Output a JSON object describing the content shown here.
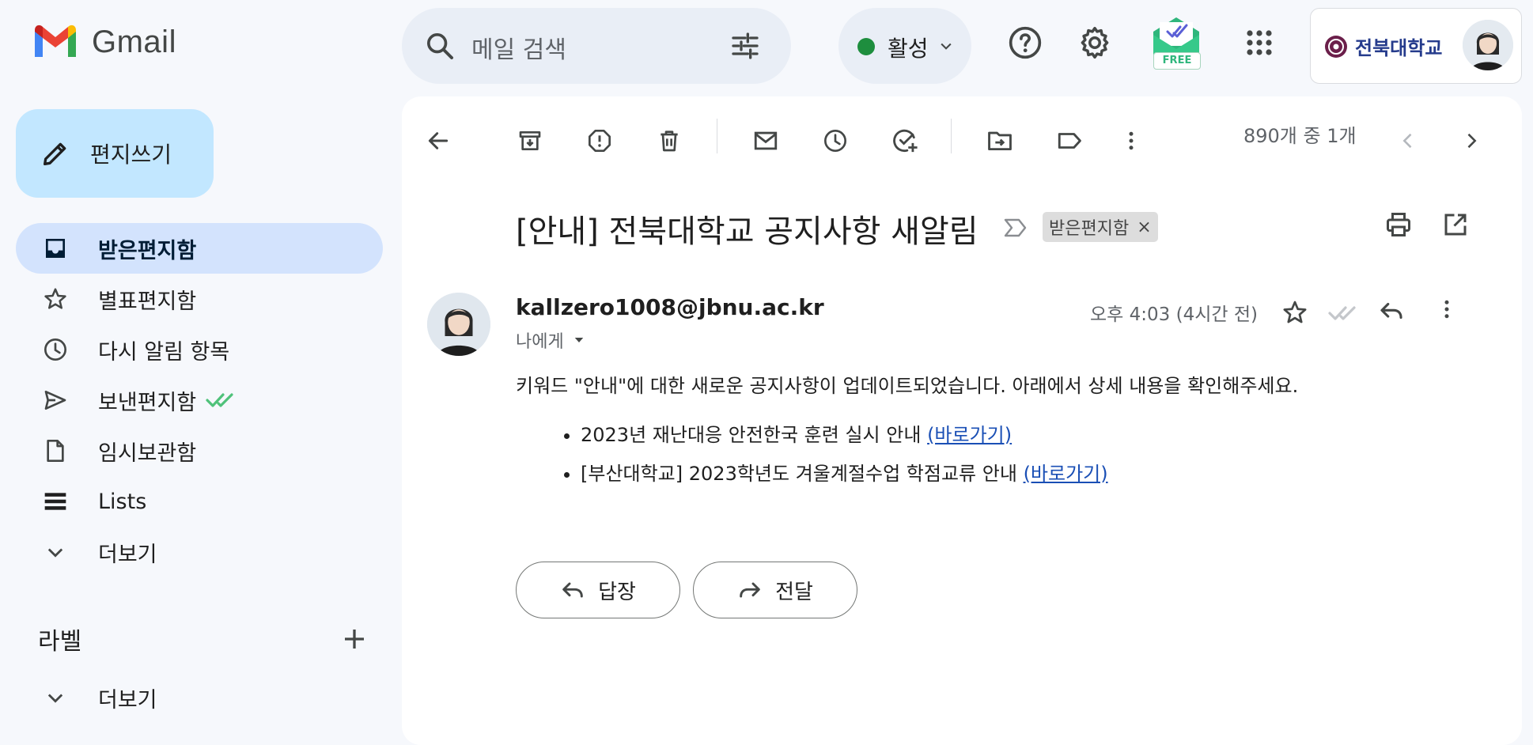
{
  "header": {
    "app_name": "Gmail",
    "search_placeholder": "메일 검색",
    "status_label": "활성",
    "free_badge": "FREE",
    "account_org": "전북대학교"
  },
  "sidebar": {
    "compose_label": "편지쓰기",
    "items": [
      {
        "label": "받은편지함",
        "icon": "inbox-icon",
        "active": true
      },
      {
        "label": "별표편지함",
        "icon": "star-icon"
      },
      {
        "label": "다시 알림 항목",
        "icon": "clock-icon"
      },
      {
        "label": "보낸편지함",
        "icon": "send-icon"
      },
      {
        "label": "임시보관함",
        "icon": "draft-icon"
      },
      {
        "label": "Lists",
        "icon": "lists-icon"
      },
      {
        "label": "더보기",
        "icon": "chevron-down-icon"
      }
    ],
    "labels_title": "라벨",
    "labels_more": "더보기"
  },
  "toolbar": {
    "count_text": "890개 중 1개"
  },
  "message": {
    "subject": "[안내] 전북대학교 공지사항 새알림",
    "label_chip": "받은편지함",
    "chip_close": "×",
    "sender": "kallzero1008@jbnu.ac.kr",
    "to_me": "나에게",
    "time": "오후 4:03 (4시간 전)",
    "body_intro": "키워드 \"안내\"에 대한 새로운 공지사항이 업데이트되었습니다. 아래에서 상세 내용을 확인해주세요.",
    "items": [
      {
        "text": "2023년 재난대응 안전한국 훈련 실시 안내 ",
        "link": "(바로가기)"
      },
      {
        "text": "[부산대학교] 2023학년도 겨울계절수업 학점교류 안내 ",
        "link": "(바로가기)"
      }
    ],
    "reply_label": "답장",
    "forward_label": "전달"
  },
  "colors": {
    "background": "#f6f8fc",
    "compose": "#c2e7ff",
    "active_nav": "#d3e3fd",
    "status_dot": "#1e8e3e",
    "link": "#1a4fb5"
  }
}
